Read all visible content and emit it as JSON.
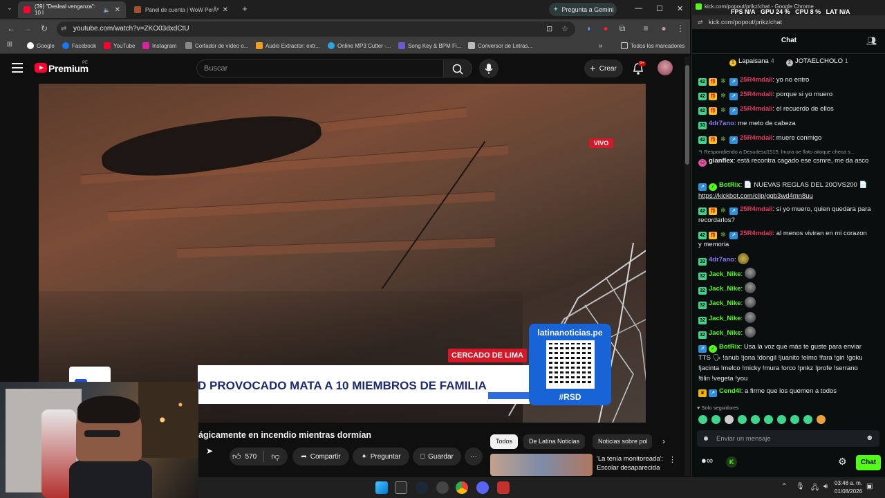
{
  "browser": {
    "tabs": [
      {
        "label": "(39) \"Desleal venganza\": 10 l",
        "active": true
      },
      {
        "label": "Panel de cuenta | WoW PerÃº",
        "active": false
      }
    ],
    "gemini_label": "Pregunta a Gemini",
    "url": "youtube.com/watch?v=ZKO03dxdCtU",
    "bookmarks": [
      "Google",
      "Facebook",
      "YouTube",
      "Instagram",
      "Cortador de vídeo o...",
      "Audio Extractor: extr...",
      "Online MP3 Cutter -...",
      "Song Key & BPM Fi...",
      "Conversor de Letras..."
    ],
    "all_bookmarks": "Todos los marcadores"
  },
  "youtube": {
    "logo_text": "Premium",
    "logo_sup": "PE",
    "search_placeholder": "Buscar",
    "create_label": "Crear",
    "notif_count": "9+",
    "live_badge": "VIVO",
    "location_tag": "CERCADO DE LIMA",
    "lower_third": "D PROVOCADO MATA A 10 MIEMBROS DE FAMILIA",
    "qr_site": "latinanoticias.pe",
    "qr_tag": "#RSD",
    "title": "ágicamente en incendio mientras dormían",
    "likes": "570",
    "share": "Compartir",
    "ask": "Preguntar",
    "save": "Guardar",
    "chips": [
      "Todos",
      "De Latina Noticias",
      "Noticias sobre pol"
    ],
    "rec_title": "'La tenía monitoreada': Escolar desaparecida ..."
  },
  "kick": {
    "window_title": "kick.com/popout/prikz/chat - Google Chrome",
    "stats": {
      "fps_label": "FPS",
      "fps": "N/A",
      "gpu_label": "GPU",
      "gpu": "24 %",
      "cpu_label": "CPU",
      "cpu": "8 %",
      "lat_label": "LAT",
      "lat": "N/A"
    },
    "url": "kick.com/popout/prikz/chat",
    "header": "Chat",
    "top_gifters": [
      {
        "rank": "1",
        "name": "Lapaisana",
        "count": "4"
      },
      {
        "rank": "2",
        "name": "JOTAELCHOLO",
        "count": "1"
      }
    ],
    "messages": [
      {
        "user": "25R4mdali",
        "text": ": yo no entro",
        "color": "#e23b5d",
        "badges": [
          "sub",
          "gift",
          "leaf",
          "vip"
        ]
      },
      {
        "user": "25R4mdali",
        "text": ": porque si yo muero",
        "color": "#e23b5d",
        "badges": [
          "sub",
          "gift",
          "leaf",
          "vip"
        ]
      },
      {
        "user": "25R4mdali",
        "text": ": el recuerdo de ellos",
        "color": "#e23b5d",
        "badges": [
          "sub",
          "gift",
          "leaf",
          "vip"
        ]
      },
      {
        "user": "4dr7ano",
        "text": ": me meto de cabeza",
        "color": "#8e7cf0",
        "badges": [
          "sub"
        ]
      },
      {
        "user": "25R4mdali",
        "text": ": muere conmigo",
        "color": "#e23b5d",
        "badges": [
          "sub",
          "gift",
          "leaf",
          "vip"
        ]
      }
    ],
    "reply_note": "Respondiendo a Desudesu1515: lmura oe flato aitoque checa s...",
    "gianflex": {
      "user": "gianflex",
      "text": ": está recontra cagado ese csmre, me da asco"
    },
    "botrix1": {
      "user": "BotRix",
      "text": ": 📄 NUEVAS REGLAS DEL 20OVS200 📄",
      "link": "https://kickbot.com/clip/ggb3wd4mn8uu"
    },
    "m7": {
      "user": "25R4mdali",
      "text": ": si yo muero, quien quedara para recordarlos?"
    },
    "m8": {
      "user": "25R4mdali",
      "text": ": al menos viviran en mi corazon y memoria"
    },
    "m9": {
      "user": "4dr7ano",
      "text": ":"
    },
    "jack": {
      "user": "Jack_Nike",
      "text": ":"
    },
    "botrix2": {
      "user": "BotRix",
      "text": ": Usa la voz que más te guste para enviar TTS 🗣 !anub !jona !dongil !juanito !elmo !fara !giri !goku !jacinta !melco !micky !mura !orco !pnkz !profe !serrano !tilin !vegeta !you"
    },
    "cend": {
      "user": "Cend4l",
      "text": ": a firme que los quemen a todos"
    },
    "followers_only": "Solo seguidores",
    "input_placeholder": "Enviar un mensaje",
    "chat_button": "Chat"
  },
  "taskbar": {
    "time": "03:48 a. m.",
    "date": "01/08/2026"
  },
  "colors": {
    "kick_green": "#53fc18",
    "yt_red": "#ff0033",
    "live_red": "#d3192a"
  }
}
